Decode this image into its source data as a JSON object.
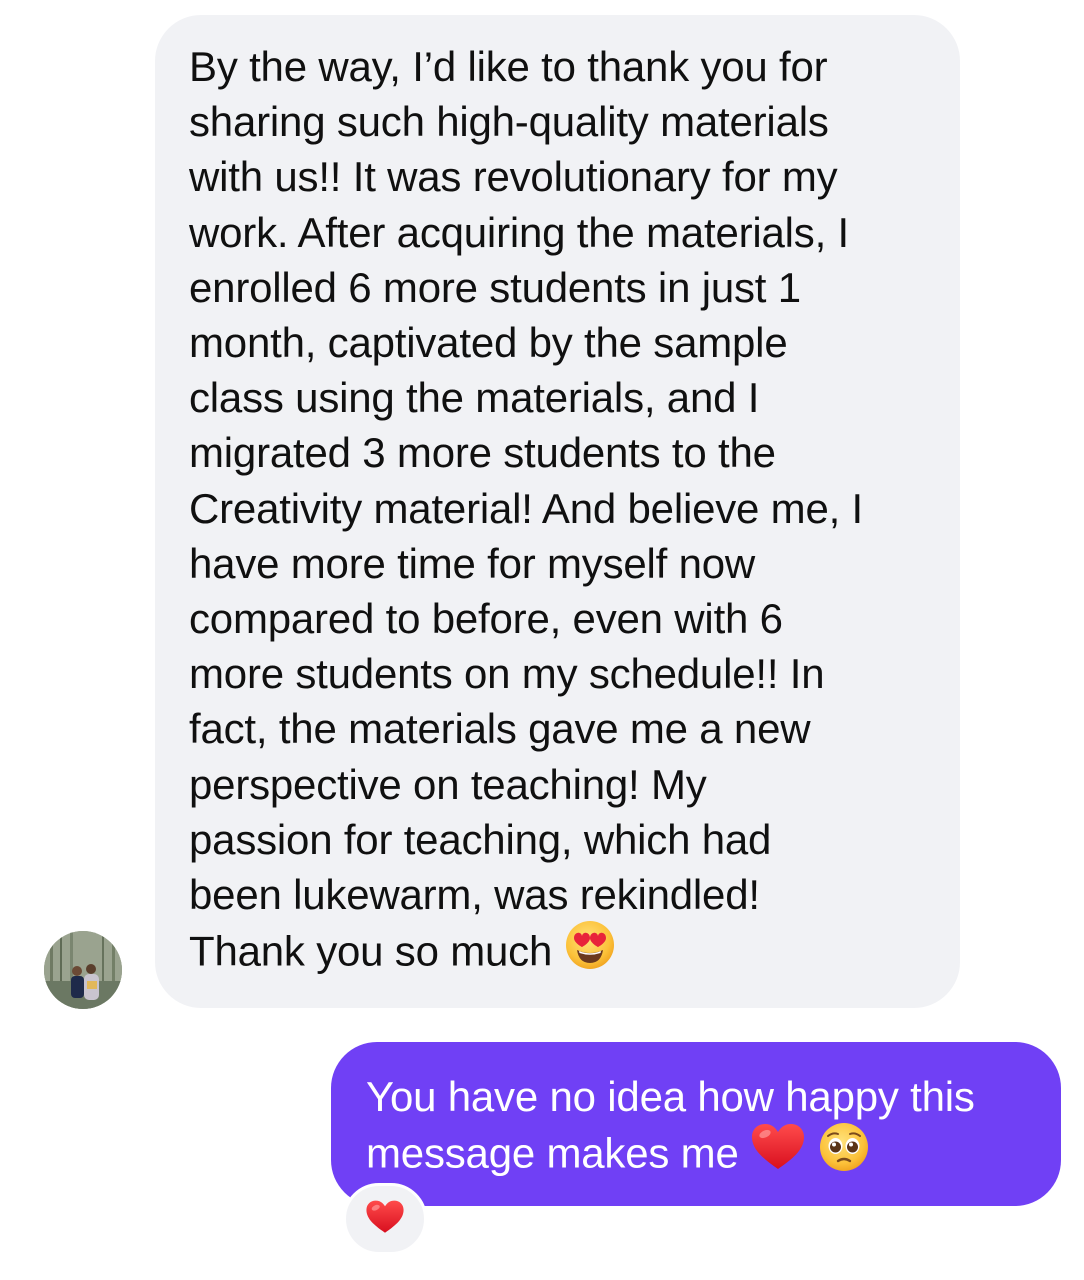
{
  "incoming_message": {
    "lines": [
      "By the way, I’d like to thank you for",
      "sharing such high-quality materials",
      "with us!! It was revolutionary for my",
      "work. After acquiring the materials, I",
      "enrolled 6 more students in just 1",
      "month, captivated by the sample",
      "class using the materials, and I",
      "migrated 3 more students to the",
      "Creativity material! And believe me, I",
      "have more time for myself now",
      "compared to before, even with 6",
      "more students on my schedule!! In",
      "fact, the materials gave me a new",
      "perspective on teaching! My",
      "passion for teaching, which had",
      "been lukewarm, was rekindled!",
      "Thank you so much"
    ],
    "trailing_emoji": "heart-eyes-emoji"
  },
  "outgoing_message": {
    "lines": [
      "You have no idea how happy this",
      "message makes me"
    ],
    "trailing_emojis": [
      "red-heart-emoji",
      "pleading-face-emoji"
    ]
  },
  "reaction": {
    "emoji": "red-heart-emoji"
  },
  "colors": {
    "incoming_bubble": "#f1f2f5",
    "outgoing_bubble": "#7040f5",
    "incoming_text": "#101010",
    "outgoing_text": "#ffffff"
  }
}
